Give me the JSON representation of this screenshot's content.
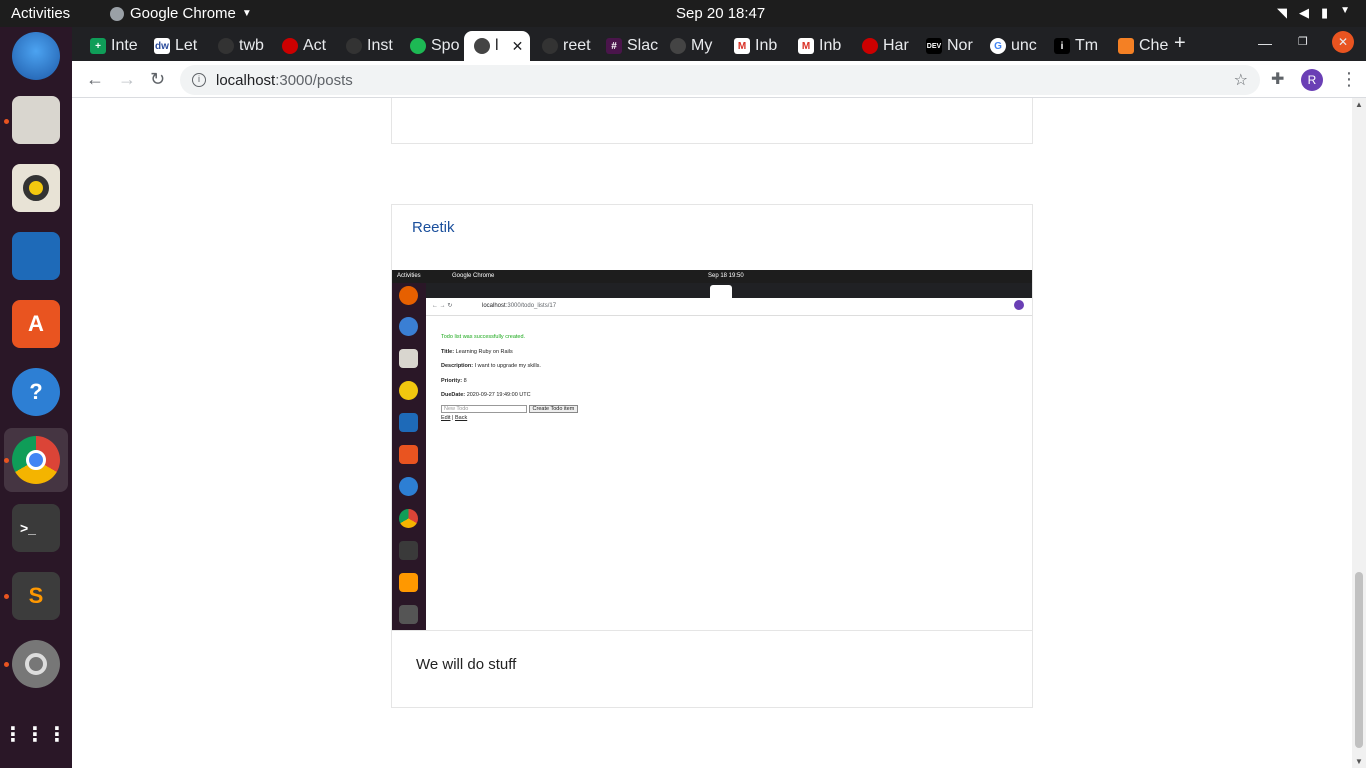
{
  "system": {
    "activities": "Activities",
    "app_name": "Google Chrome",
    "clock": "Sep 20  18:47"
  },
  "browser": {
    "tabs": [
      "Inte",
      "Let",
      "twb",
      "Act",
      "Inst",
      "Spo",
      "l",
      "reet",
      "Slac",
      "My",
      "Inb",
      "Inb",
      "Har",
      "Nor",
      "unc",
      "Tm",
      "Che"
    ],
    "url_host": "localhost",
    "url_path": ":3000/posts",
    "avatar_letter": "R",
    "accent": "#6a3fb5"
  },
  "post": {
    "author": "Reetik",
    "body": "We will do stuff"
  },
  "embedded": {
    "activities": "Activities",
    "app_name": "Google Chrome",
    "clock": "Sep 18  19:50",
    "url_host": "localhost",
    "url_path": ":3000/todo_lists/17",
    "notice": "Todo list was successfully created.",
    "title_label": "Title:",
    "title_value": "Learning Ruby on Rails",
    "desc_label": "Description:",
    "desc_value": "I want to upgrade my skills.",
    "priority_label": "Priority:",
    "priority_value": "8",
    "due_label": "DueDate:",
    "due_value": "2020-09-27 19:49:00 UTC",
    "new_todo_placeholder": "New Todo",
    "create_button": "Create Todo item",
    "edit_link": "Edit",
    "sep": "|",
    "back_link": "Back"
  }
}
